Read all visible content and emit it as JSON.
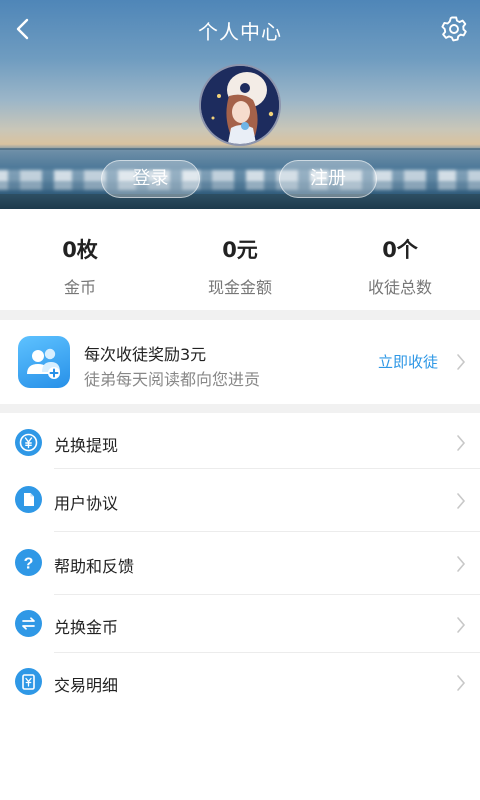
{
  "header": {
    "title": "个人中心",
    "back_icon": "chevron-left-icon",
    "settings_icon": "gear-icon",
    "login_label": "登录",
    "register_label": "注册"
  },
  "stats": [
    {
      "value": "0枚",
      "label": "金币"
    },
    {
      "value": "0元",
      "label": "现金金额"
    },
    {
      "value": "0个",
      "label": "收徒总数"
    }
  ],
  "invite": {
    "icon": "add-user-icon",
    "title": "每次收徒奖励3元",
    "subtitle": "徒弟每天阅读都向您进贡",
    "action": "立即收徒"
  },
  "menu": [
    {
      "label": "兑换提现",
      "icon": "yuan-coin-icon"
    },
    {
      "label": "用户协议",
      "icon": "document-icon"
    },
    {
      "label": "帮助和反馈",
      "icon": "question-icon"
    },
    {
      "label": "兑换金币",
      "icon": "exchange-icon"
    },
    {
      "label": "交易明细",
      "icon": "transaction-icon"
    }
  ],
  "colors": {
    "accent": "#2f98e6",
    "divider": "#f1f1f1"
  }
}
